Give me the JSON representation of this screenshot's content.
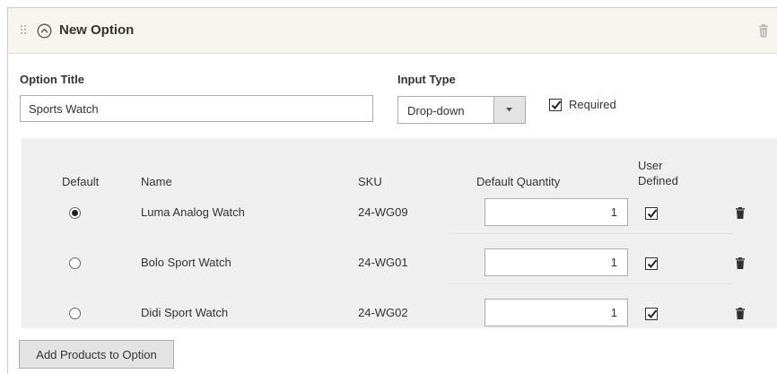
{
  "header": {
    "title": "New Option"
  },
  "form": {
    "option_title_label": "Option Title",
    "option_title_value": "Sports Watch",
    "input_type_label": "Input Type",
    "input_type_value": "Drop-down",
    "required_label": "Required",
    "required_checked": true
  },
  "grid": {
    "columns": {
      "default": "Default",
      "name": "Name",
      "sku": "SKU",
      "default_quantity": "Default Quantity",
      "user_defined_line1": "User",
      "user_defined_line2": "Defined"
    },
    "rows": [
      {
        "default": true,
        "name": "Luma Analog Watch",
        "sku": "24-WG09",
        "quantity": "1",
        "user_defined": true
      },
      {
        "default": false,
        "name": "Bolo Sport Watch",
        "sku": "24-WG01",
        "quantity": "1",
        "user_defined": true
      },
      {
        "default": false,
        "name": "Didi Sport Watch",
        "sku": "24-WG02",
        "quantity": "1",
        "user_defined": true
      }
    ]
  },
  "actions": {
    "add_products_label": "Add Products to Option"
  },
  "icons": {
    "drag": "drag-handle-icon",
    "collapse": "collapse-circle-chevron-up-icon",
    "delete": "trash-icon",
    "dropdown": "caret-down-icon",
    "check": "checkmark-icon"
  },
  "colors": {
    "header_bg": "#f8f5ef",
    "grid_bg": "#efefef",
    "button_bg": "#e3e3e3",
    "border": "#adadad"
  }
}
